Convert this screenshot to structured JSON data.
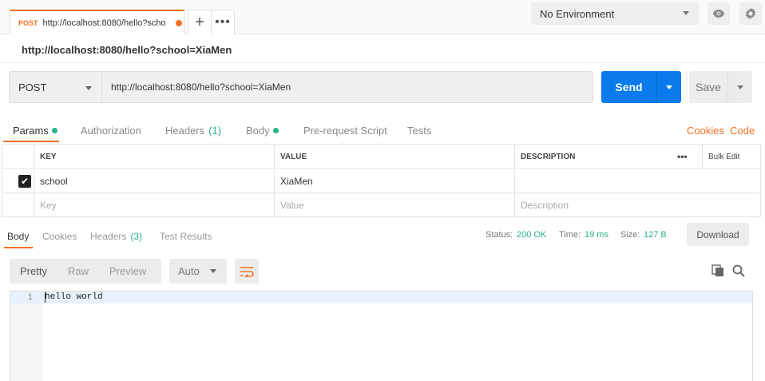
{
  "tab": {
    "method": "POST",
    "title": "http://localhost:8080/hello?scho"
  },
  "tab_actions": {
    "new": "+",
    "more": "•••"
  },
  "environment": {
    "selected": "No Environment"
  },
  "request": {
    "name": "http://localhost:8080/hello?school=XiaMen",
    "method": "POST",
    "url": "http://localhost:8080/hello?school=XiaMen"
  },
  "actions": {
    "send": "Send",
    "save": "Save"
  },
  "request_tabs": [
    {
      "label": "Params",
      "dot": true
    },
    {
      "label": "Authorization"
    },
    {
      "label": "Headers",
      "count": "(1)"
    },
    {
      "label": "Body",
      "dot": true
    },
    {
      "label": "Pre-request Script"
    },
    {
      "label": "Tests"
    }
  ],
  "links": {
    "cookies": "Cookies",
    "code": "Code"
  },
  "params": {
    "headers": {
      "key": "KEY",
      "value": "VALUE",
      "description": "DESCRIPTION",
      "more": "•••",
      "bulk_edit": "Bulk Edit"
    },
    "rows": [
      {
        "key": "school",
        "value": "XiaMen",
        "description": "",
        "checked": true
      }
    ],
    "placeholder": {
      "key": "Key",
      "value": "Value",
      "description": "Description"
    }
  },
  "response_tabs": [
    {
      "label": "Body"
    },
    {
      "label": "Cookies"
    },
    {
      "label": "Headers",
      "count": "(3)"
    },
    {
      "label": "Test Results"
    }
  ],
  "status": {
    "status_label": "Status:",
    "status_value": "200 OK",
    "time_label": "Time:",
    "time_value": "19 ms",
    "size_label": "Size:",
    "size_value": "127 B"
  },
  "download": "Download",
  "view": {
    "modes": [
      "Pretty",
      "Raw",
      "Preview"
    ],
    "active_mode": "Pretty",
    "format": "Auto"
  },
  "body": {
    "lines": [
      {
        "number": "1",
        "text": "hello world"
      }
    ]
  },
  "colors": {
    "accent": "#f47023",
    "send": "#097bed",
    "success": "#26b47f"
  }
}
